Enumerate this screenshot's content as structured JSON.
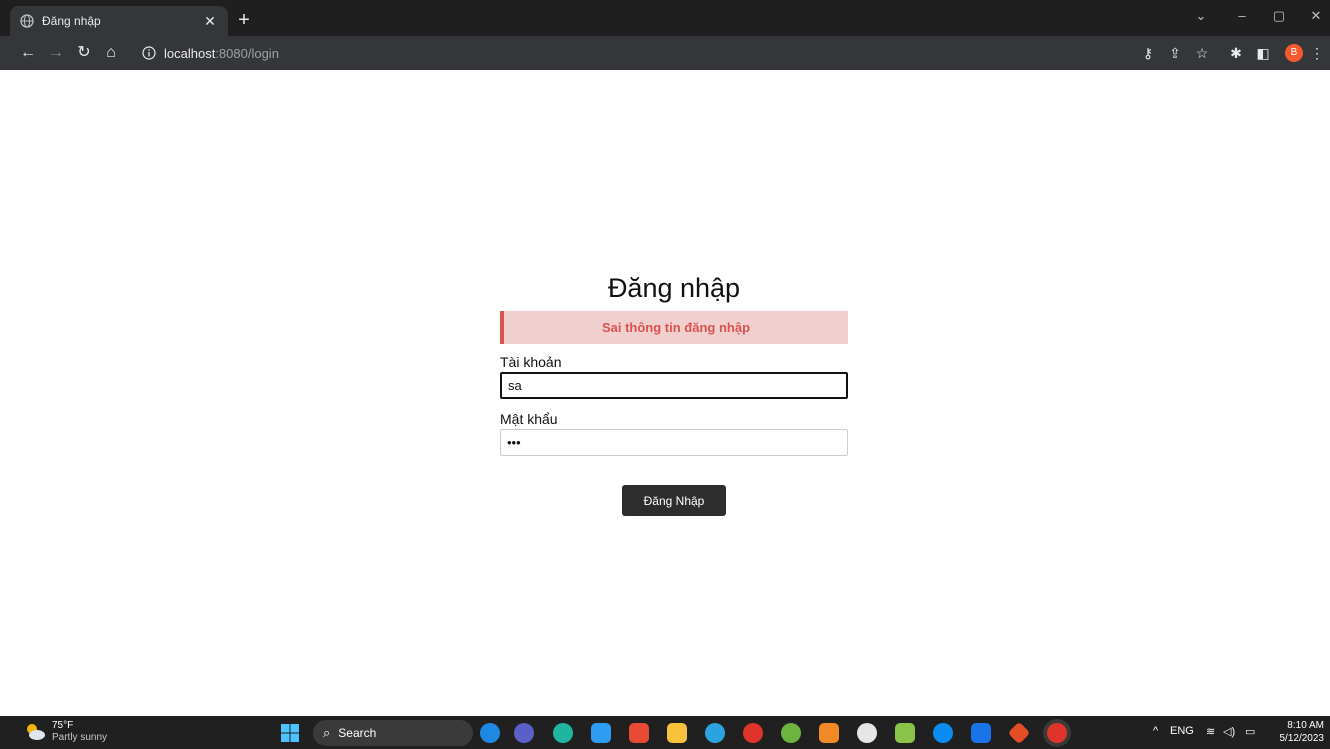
{
  "browser": {
    "tab_title": "Đăng nhập",
    "url_host": "localhost",
    "url_path": ":8080/login"
  },
  "login": {
    "heading": "Đăng nhập",
    "error_message": "Sai thông tin đăng nhập",
    "username_label": "Tài khoản",
    "username_value": "sa",
    "password_label": "Mật khẩu",
    "password_value": "•••",
    "submit_label": "Đăng Nhập"
  },
  "taskbar": {
    "temperature": "75°F",
    "weather": "Partly sunny",
    "search_label": "Search",
    "language": "ENG",
    "time": "8:10 AM",
    "date": "5/12/2023"
  },
  "profile_initial": "B",
  "colors": {
    "alert_bg": "#f2cfcf",
    "alert_text": "#d9534f",
    "button_bg": "#2d2d2d"
  }
}
